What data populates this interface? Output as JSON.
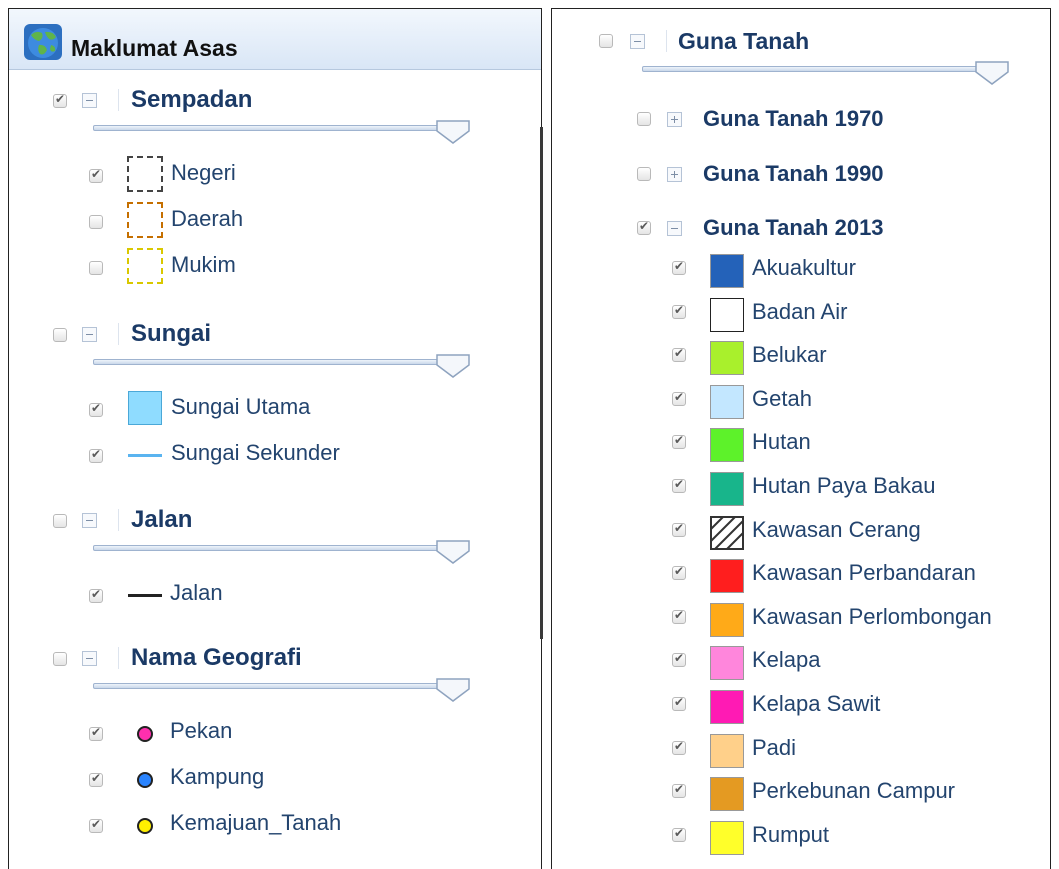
{
  "left_panel": {
    "title": "Maklumat Asas",
    "icon": "globe-icon",
    "groups": [
      {
        "title": "Sempadan",
        "checked": true,
        "expanded": true,
        "items": [
          {
            "label": "Negeri",
            "checked": true,
            "symbol": "dashed-box",
            "color": "#444444"
          },
          {
            "label": "Daerah",
            "checked": false,
            "symbol": "dashed-box",
            "color": "#c56f00"
          },
          {
            "label": "Mukim",
            "checked": false,
            "symbol": "dashed-box",
            "color": "#d9c800"
          }
        ]
      },
      {
        "title": "Sungai",
        "checked": false,
        "expanded": true,
        "items": [
          {
            "label": "Sungai Utama",
            "checked": true,
            "symbol": "fill-box",
            "color": "#8fdcff"
          },
          {
            "label": "Sungai Sekunder",
            "checked": true,
            "symbol": "line",
            "color": "#5ab4f0"
          }
        ]
      },
      {
        "title": "Jalan",
        "checked": false,
        "expanded": true,
        "items": [
          {
            "label": "Jalan",
            "checked": true,
            "symbol": "line",
            "color": "#222222"
          }
        ]
      },
      {
        "title": "Nama Geografi",
        "checked": false,
        "expanded": true,
        "items": [
          {
            "label": "Pekan",
            "checked": true,
            "symbol": "dot",
            "color": "#ff2fae"
          },
          {
            "label": "Kampung",
            "checked": true,
            "symbol": "dot",
            "color": "#2a84ff"
          },
          {
            "label": "Kemajuan_Tanah",
            "checked": true,
            "symbol": "dot",
            "color": "#ffef00"
          }
        ]
      }
    ]
  },
  "right_panel": {
    "group": {
      "title": "Guna Tanah",
      "checked": false,
      "expanded": true
    },
    "subgroups": [
      {
        "title": "Guna Tanah 1970",
        "checked": false,
        "expanded": false
      },
      {
        "title": "Guna Tanah 1990",
        "checked": false,
        "expanded": false
      },
      {
        "title": "Guna Tanah 2013",
        "checked": true,
        "expanded": true
      }
    ],
    "items": [
      {
        "label": "Akuakultur",
        "checked": true,
        "color": "#2462b9"
      },
      {
        "label": "Badan Air",
        "checked": true,
        "color": "#ffffff"
      },
      {
        "label": "Belukar",
        "checked": true,
        "color": "#a9f02c"
      },
      {
        "label": "Getah",
        "checked": true,
        "color": "#c3e7ff"
      },
      {
        "label": "Hutan",
        "checked": true,
        "color": "#5df22a"
      },
      {
        "label": "Hutan Paya Bakau",
        "checked": true,
        "color": "#18b58b"
      },
      {
        "label": "Kawasan Cerang",
        "checked": true,
        "color": "hatched"
      },
      {
        "label": "Kawasan Perbandaran",
        "checked": true,
        "color": "#ff1e1e"
      },
      {
        "label": "Kawasan Perlombongan",
        "checked": true,
        "color": "#ffaa18"
      },
      {
        "label": "Kelapa",
        "checked": true,
        "color": "#ff86dc"
      },
      {
        "label": "Kelapa Sawit",
        "checked": true,
        "color": "#ff1ab4"
      },
      {
        "label": "Padi",
        "checked": true,
        "color": "#ffd08a"
      },
      {
        "label": "Perkebunan Campur",
        "checked": true,
        "color": "#e49a22"
      },
      {
        "label": "Rumput",
        "checked": true,
        "color": "#ffff2a"
      }
    ]
  }
}
